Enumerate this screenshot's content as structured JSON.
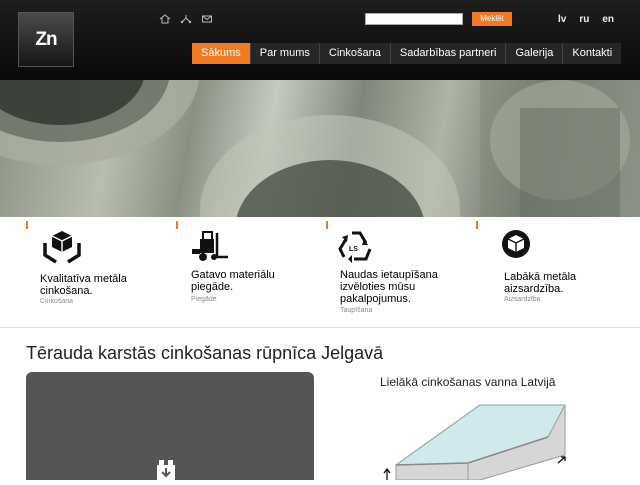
{
  "logo": {
    "text": "Zn"
  },
  "top_icons": [
    "home-icon",
    "sitemap-icon",
    "mail-icon"
  ],
  "search": {
    "value": "",
    "button_label": "Meklēt"
  },
  "languages": [
    "lv",
    "ru",
    "en"
  ],
  "nav": {
    "items": [
      "Sākums",
      "Par mums",
      "Cinkošana",
      "Sadarbības partneri",
      "Galerija",
      "Kontakti"
    ],
    "active_index": 0
  },
  "accent_color": "#f07a23",
  "features": [
    {
      "title": "Kvalitatīva metāla\ncinkošana.",
      "subtitle": "Cinkošana",
      "icon": "box-hands-icon"
    },
    {
      "title": "Gatavo materiālu\npiegāde.",
      "subtitle": "Piegāde",
      "icon": "forklift-icon"
    },
    {
      "title": "Naudas ietaupīšana\nizvēloties mūsu\npakalpojumus.",
      "subtitle": "Taupīšana",
      "icon": "recycle-icon"
    },
    {
      "title": "Labākā metāla\naizsardzība.",
      "subtitle": "Aizsardzība",
      "icon": "shield-box-icon"
    }
  ],
  "main": {
    "title": "Tērauda karstās cinkošanas rūpnīca Jelgavā",
    "vat_title": "Lielākā cinkošanas vanna Latvijā"
  }
}
